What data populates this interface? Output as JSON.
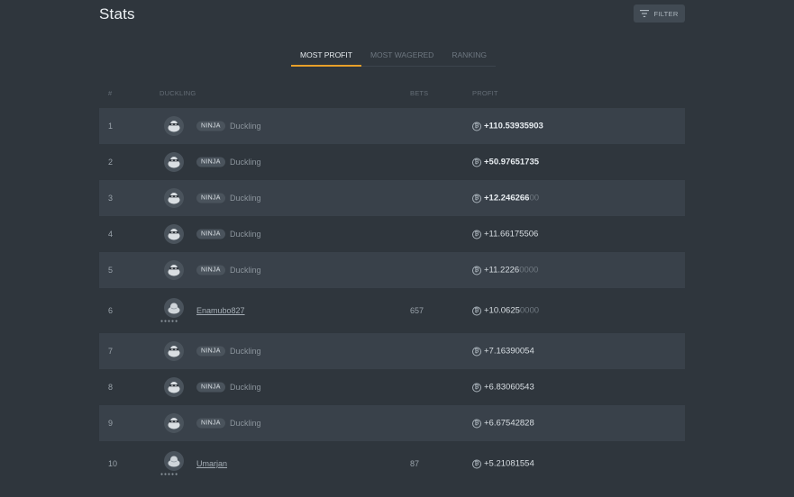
{
  "page": {
    "title": "Stats"
  },
  "filter": {
    "label": "FILTER",
    "icon": "filter-icon"
  },
  "tabs": [
    {
      "label": "MOST PROFIT",
      "active": true
    },
    {
      "label": "MOST WAGERED",
      "active": false
    },
    {
      "label": "RANKING",
      "active": false
    }
  ],
  "table": {
    "headers": {
      "rank": "#",
      "user": "DUCKLING",
      "bets": "BETS",
      "profit": "PROFIT"
    },
    "rows": [
      {
        "rank": "1",
        "type": "ninja",
        "badge": "NINJA",
        "name": "Duckling",
        "bets": "",
        "profit_main": "+110.53935903",
        "profit_fade": ""
      },
      {
        "rank": "2",
        "type": "ninja",
        "badge": "NINJA",
        "name": "Duckling",
        "bets": "",
        "profit_main": "+50.97651735",
        "profit_fade": ""
      },
      {
        "rank": "3",
        "type": "ninja",
        "badge": "NINJA",
        "name": "Duckling",
        "bets": "",
        "profit_main": "+12.246266",
        "profit_fade": "00"
      },
      {
        "rank": "4",
        "type": "ninja",
        "badge": "NINJA",
        "name": "Duckling",
        "bets": "",
        "profit_main": "+11.66175506",
        "profit_fade": ""
      },
      {
        "rank": "5",
        "type": "ninja",
        "badge": "NINJA",
        "name": "Duckling",
        "bets": "",
        "profit_main": "+11.2226",
        "profit_fade": "0000"
      },
      {
        "rank": "6",
        "type": "user",
        "badge": "",
        "name": "Enamubo827",
        "bets": "657",
        "profit_main": "+10.0625",
        "profit_fade": "0000"
      },
      {
        "rank": "7",
        "type": "ninja",
        "badge": "NINJA",
        "name": "Duckling",
        "bets": "",
        "profit_main": "+7.16390054",
        "profit_fade": ""
      },
      {
        "rank": "8",
        "type": "ninja",
        "badge": "NINJA",
        "name": "Duckling",
        "bets": "",
        "profit_main": "+6.83060543",
        "profit_fade": ""
      },
      {
        "rank": "9",
        "type": "ninja",
        "badge": "NINJA",
        "name": "Duckling",
        "bets": "",
        "profit_main": "+6.67542828",
        "profit_fade": ""
      },
      {
        "rank": "10",
        "type": "user",
        "badge": "",
        "name": "Umarjan",
        "bets": "87",
        "profit_main": "+5.21081554",
        "profit_fade": ""
      }
    ]
  },
  "icons": {
    "coin": "bitcoin-icon",
    "avatar": "duck-avatar-icon",
    "level": "level-stars-icon"
  },
  "colors": {
    "accent": "#e8a02a",
    "background": "#2f363d",
    "row_shade": "#39414a"
  }
}
